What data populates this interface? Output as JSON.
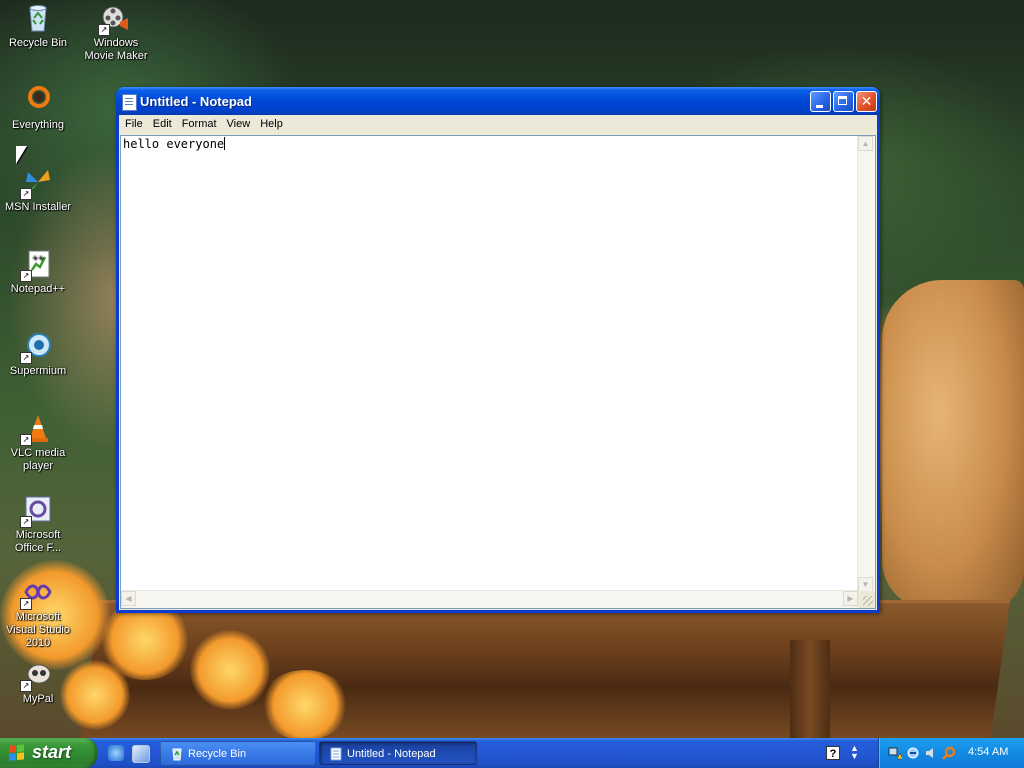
{
  "desktop": {
    "icons": [
      {
        "label": "Recycle Bin",
        "icon": "recycle-bin-icon"
      },
      {
        "label": "Windows Movie Maker",
        "icon": "movie-maker-icon"
      },
      {
        "label": "Everything",
        "icon": "everything-search-icon"
      },
      {
        "label": "MSN Installer",
        "icon": "msn-butterfly-icon"
      },
      {
        "label": "Notepad++",
        "icon": "notepad-plus-plus-icon"
      },
      {
        "label": "Supermium",
        "icon": "supermium-browser-icon"
      },
      {
        "label": "VLC media player",
        "icon": "vlc-cone-icon"
      },
      {
        "label": "Microsoft Office F...",
        "icon": "office-icon"
      },
      {
        "label": "Microsoft Visual Studio 2010",
        "icon": "visual-studio-icon"
      },
      {
        "label": "MyPal",
        "icon": "mypal-browser-icon"
      }
    ]
  },
  "notepad": {
    "title": "Untitled - Notepad",
    "menu": [
      "File",
      "Edit",
      "Format",
      "View",
      "Help"
    ],
    "content": "hello everyone",
    "close_glyph": "✕"
  },
  "taskbar": {
    "start_label": "start",
    "tasks": [
      {
        "label": "Recycle Bin",
        "active": false
      },
      {
        "label": "Untitled - Notepad",
        "active": true
      }
    ],
    "clock": "4:54 AM"
  },
  "colors": {
    "taskbar_blue": "#245edb",
    "start_green": "#3c9c3c",
    "title_blue": "#0047d6",
    "tray_blue": "#128ae2"
  }
}
